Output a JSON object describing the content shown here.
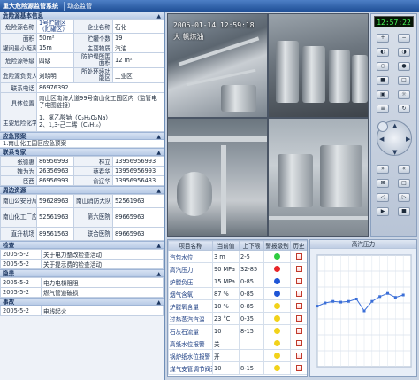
{
  "titlebar": {
    "app": "重大危险源监管系统",
    "tab": "动态监管"
  },
  "basic": {
    "header": "危险源基本信息",
    "name_label": "危险源名称",
    "name_value": "1号贮罐区（贮罐区）",
    "company_label": "企业名称",
    "company_value": "石化",
    "area_label": "面积",
    "area_value": "50m²",
    "tanks_label": "贮罐个数",
    "tanks_value": "19",
    "distance_label": "罐间最小距离",
    "distance_value": "15m",
    "material_label": "主要物质",
    "material_value": "汽油",
    "level_label": "危险源等级",
    "level_value": "四级",
    "fire_label": "防护堤所围面积",
    "fire_value": "12 m²",
    "person_label": "危险源负责人",
    "person_value": "刘晓明",
    "env_label": "所处环境功能区",
    "env_value": "工业区",
    "phone_label": "联系电话",
    "phone_value": "86976392",
    "location_label": "具体位置",
    "location_value": "南山区南海大道99号南山化工园区内（监管电子电图链接）",
    "chem_label": "主要危险化学品",
    "chem_value_1": "1、氯乙酸钠（C₂H₂O₂Na）",
    "chem_value_2": "2、1,3-己二烯（C₆H₁₀）"
  },
  "plan": {
    "header": "应急预案",
    "items": [
      "1.南山化工园区应急预案"
    ]
  },
  "contacts": {
    "header": "联系专家",
    "rows": [
      [
        "张德惠",
        "86956993",
        "林立",
        "13956956993"
      ],
      [
        "魏为为",
        "26356963",
        "蔡春华",
        "13956956993"
      ],
      [
        "臣西",
        "86956993",
        "俞辽华",
        "13956956433"
      ]
    ]
  },
  "resources": {
    "header": "周边资源",
    "rows": [
      [
        "南山公安分局",
        "59628963",
        "南山消防大队",
        "52561963"
      ],
      [
        "南山化工厂应急指挥中心",
        "52561963",
        "第六医院",
        "89665963"
      ],
      [
        "直升机场",
        "89561563",
        "联合医院",
        "89665963"
      ]
    ]
  },
  "inspection": {
    "header": "检查",
    "rows": [
      [
        "2005-5-2",
        "关于电力整改检查活动"
      ],
      [
        "2005-5-2",
        "关于提示费的检查活动"
      ]
    ]
  },
  "hazard": {
    "header": "隐患",
    "rows": [
      [
        "2005-5-2",
        "电力电梯阻阻"
      ],
      [
        "2005-5-2",
        "燃气管道破损"
      ]
    ]
  },
  "accident": {
    "header": "事故",
    "rows": [
      [
        "2005-5-2",
        "电线起火"
      ]
    ]
  },
  "video": {
    "osd_date": "2006-01-14 12:59:18",
    "osd_place": "大 帆炼油",
    "osd_time_right": ""
  },
  "controls": {
    "clock": "12:57:22"
  },
  "monitor": {
    "headers": [
      "项目名称",
      "当前值",
      "上下限",
      "警报级别",
      "历史"
    ],
    "rows": [
      {
        "name": "汽包水位",
        "value": "3 m",
        "limit": "2-5",
        "color": "#2ecc40"
      },
      {
        "name": "高汽压力",
        "value": "90 MPa",
        "limit": "32-85",
        "color": "#e8262a"
      },
      {
        "name": "炉膛负压",
        "value": "15 MPa",
        "limit": "0-85",
        "color": "#1f55d6"
      },
      {
        "name": "烟气含氧",
        "value": "87 %",
        "limit": "0-85",
        "color": "#1f55d6"
      },
      {
        "name": "炉膛氧含量",
        "value": "10 %",
        "limit": "0-85",
        "color": "#f2d21a"
      },
      {
        "name": "过热蒸汽汽温",
        "value": "23 °C",
        "limit": "0-35",
        "color": "#f2d21a"
      },
      {
        "name": "石灰石流量",
        "value": "10",
        "limit": "8-15",
        "color": "#f2d21a"
      },
      {
        "name": "高纸水位报警",
        "value": "关",
        "limit": "",
        "color": "#f2d21a"
      },
      {
        "name": "锅炉纸水位报警",
        "value": "开",
        "limit": "",
        "color": "#f2d21a"
      },
      {
        "name": "煤气支管调节阀开度",
        "value": "10",
        "limit": "8-15",
        "color": "#f2d21a"
      }
    ]
  },
  "chart_data": {
    "type": "line",
    "title": "高汽压力",
    "x": [
      0,
      1,
      2,
      3,
      4,
      5,
      6,
      7,
      8,
      9,
      10,
      11
    ],
    "values": [
      76,
      80,
      82,
      81,
      82,
      85,
      70,
      82,
      88,
      92,
      87,
      90
    ],
    "ylim": [
      0,
      140
    ],
    "xlim": [
      0,
      12
    ],
    "grid": true,
    "color": "#3b6fd8"
  }
}
